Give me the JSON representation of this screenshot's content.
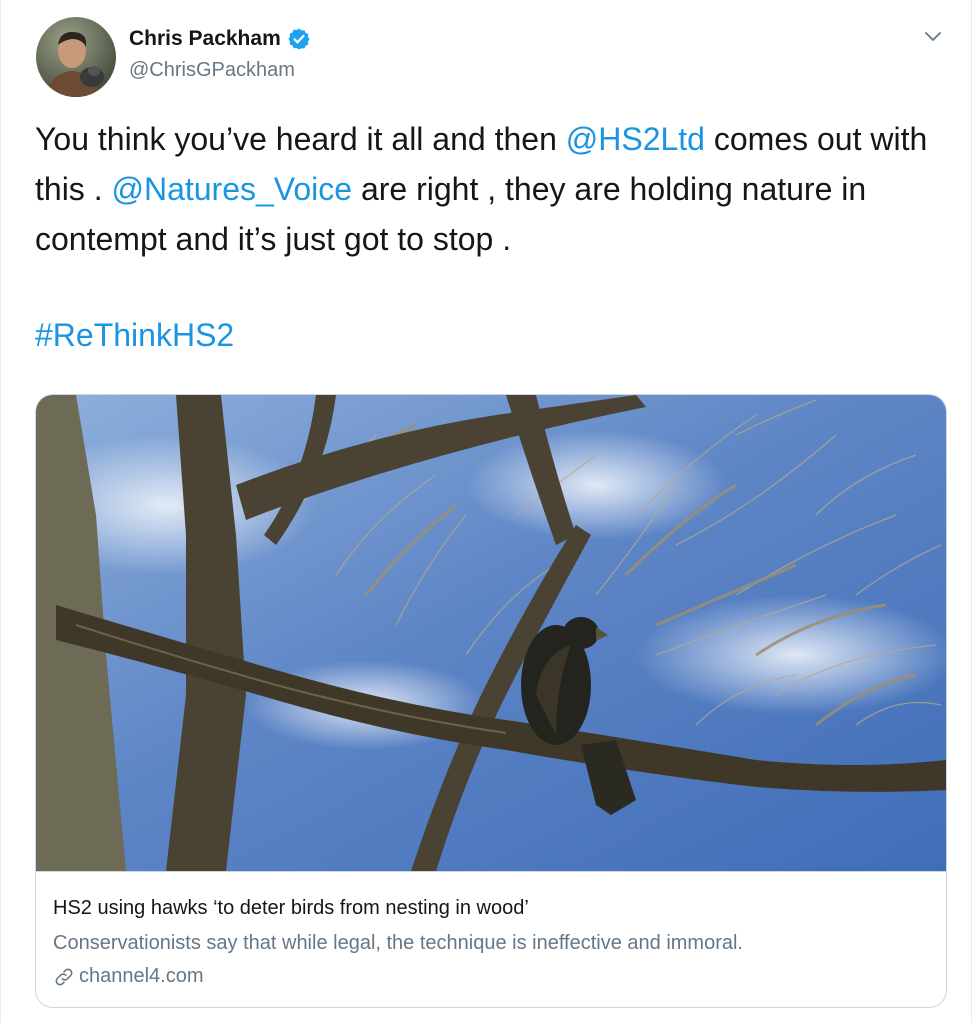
{
  "author": {
    "display_name": "Chris Packham",
    "handle": "@ChrisGPackham",
    "verified": true,
    "avatar_icon": "profile-photo"
  },
  "tweet": {
    "p1_a": "You think you’ve heard it all and then ",
    "mention1": "@HS2Ltd",
    "p1_b": " comes out with this . ",
    "mention2": "@Natures_Voice",
    "p1_c": " are right , they are holding nature in contempt and it’s just got to stop .",
    "hashtag": "#ReThinkHS2"
  },
  "card": {
    "title": "HS2 using hawks ‘to deter birds from nesting in wood’",
    "description": "Conservationists say that while legal, the technique is ineffective and immoral.",
    "domain": "channel4.com"
  },
  "colors": {
    "link": "#1b95e0",
    "verified": "#1da1f2",
    "secondary_text": "#657786",
    "border": "#ccd6dd"
  }
}
